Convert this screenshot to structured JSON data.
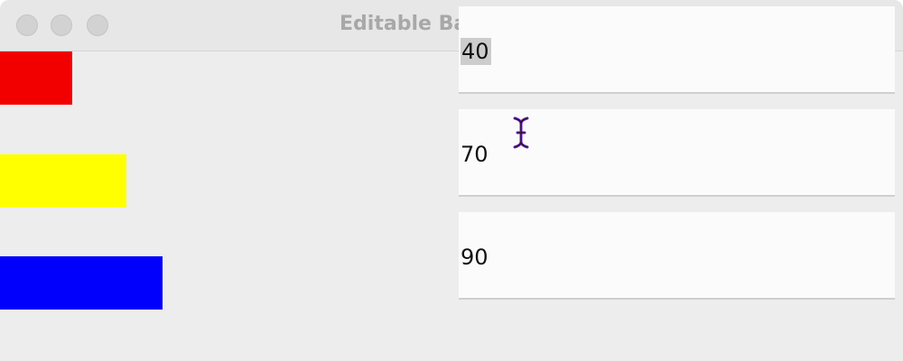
{
  "window": {
    "title": "Editable Bar Graphs"
  },
  "bars": [
    {
      "value": 40,
      "color": "#f20000"
    },
    {
      "value": 70,
      "color": "#ffff00"
    },
    {
      "value": 90,
      "color": "#0000fc"
    }
  ],
  "fields": [
    {
      "value": "40",
      "selected": true
    },
    {
      "value": "70",
      "selected": false
    },
    {
      "value": "90",
      "selected": false
    }
  ],
  "cursor": {
    "icon": "text-cursor-icon"
  }
}
